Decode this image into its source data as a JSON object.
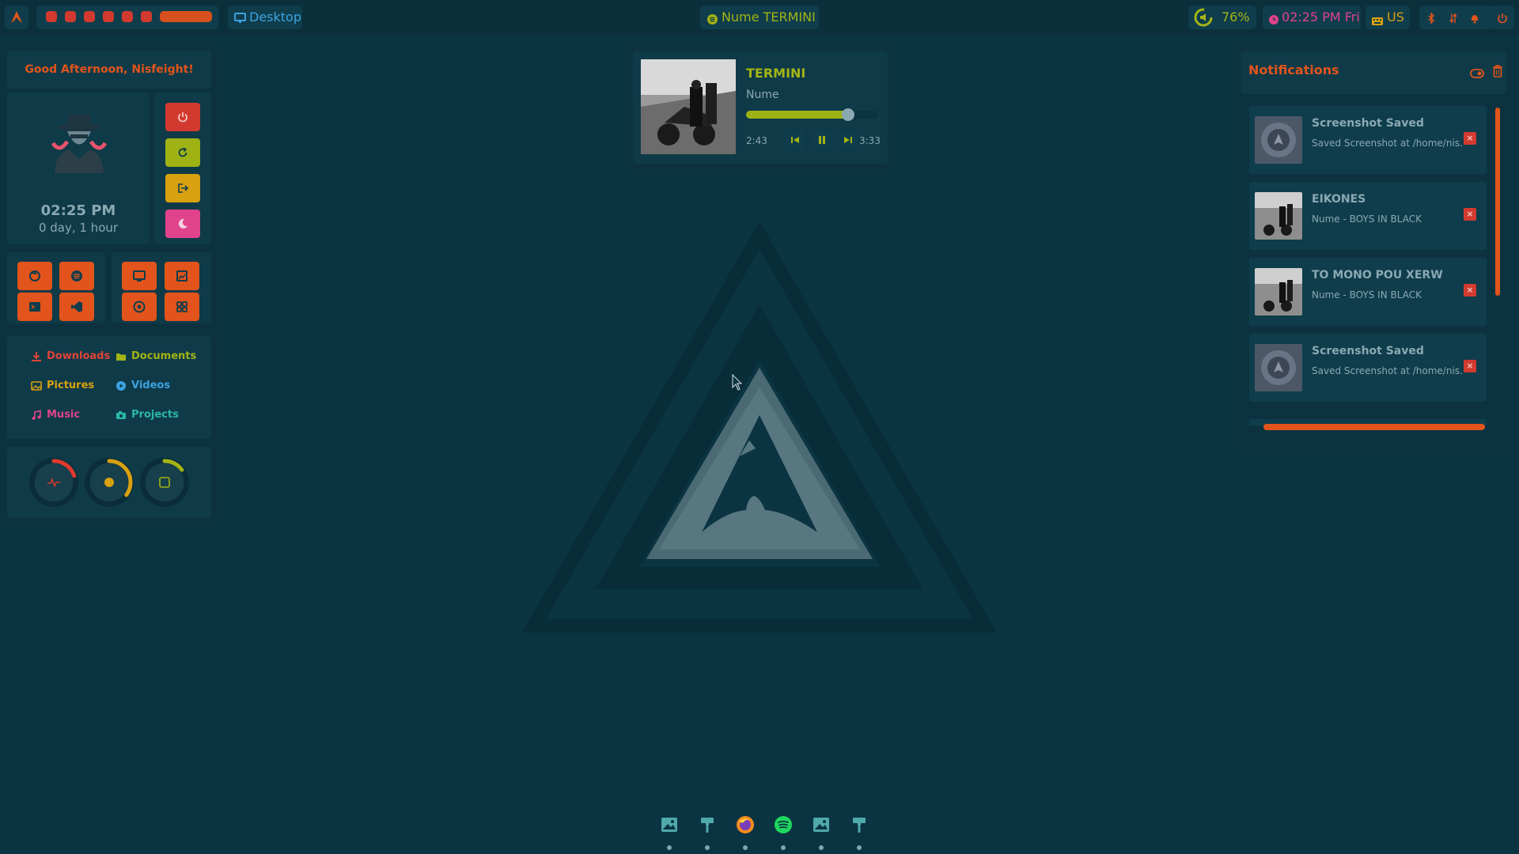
{
  "topbar": {
    "desktop_label": "Desktop",
    "now_playing": "Nume TERMINI",
    "volume": "76%",
    "clock": "02:25 PM Fri",
    "keyboard": "US",
    "workspaces_count": 6
  },
  "profile": {
    "greeting": "Good Afternoon, Nisfeight!",
    "time": "02:25 PM",
    "uptime": "0 day, 1 hour"
  },
  "power_buttons": [
    {
      "name": "power",
      "color": "#d33a2f",
      "icon": "power-icon"
    },
    {
      "name": "reboot",
      "color": "#9fb214",
      "icon": "reboot-icon"
    },
    {
      "name": "logout",
      "color": "#d8a10f",
      "icon": "logout-icon"
    },
    {
      "name": "sleep",
      "color": "#e0438b",
      "icon": "moon-icon"
    }
  ],
  "app_launchers": [
    "firefox-icon",
    "spotify-icon",
    "terminal-icon",
    "vscode-icon"
  ],
  "tool_launchers": [
    "screenshot-icon",
    "screenshot-region-icon",
    "record-icon",
    "grid-icon"
  ],
  "folders": [
    {
      "label": "Downloads",
      "color": "#e04438",
      "icon": "download-icon"
    },
    {
      "label": "Documents",
      "color": "#a3b414",
      "icon": "folder-icon"
    },
    {
      "label": "Pictures",
      "color": "#d8a10f",
      "icon": "image-icon"
    },
    {
      "label": "Videos",
      "color": "#3da2e0",
      "icon": "video-icon"
    },
    {
      "label": "Music",
      "color": "#e0438b",
      "icon": "music-icon"
    },
    {
      "label": "Projects",
      "color": "#2bb8a8",
      "icon": "camera-icon"
    }
  ],
  "gauges": [
    {
      "name": "cpu",
      "color": "#e03a2f",
      "fraction": 0.2
    },
    {
      "name": "ram",
      "color": "#d8a10f",
      "fraction": 0.35
    },
    {
      "name": "disk",
      "color": "#a3b414",
      "fraction": 0.15
    }
  ],
  "player": {
    "title": "TERMINI",
    "artist": "Nume",
    "elapsed": "2:43",
    "total": "3:33",
    "progress": 0.77
  },
  "notifications": {
    "header": "Notifications",
    "items": [
      {
        "title": "Screenshot Saved",
        "body": "Saved Screenshot at /home/nis...",
        "thumb": "screenshot"
      },
      {
        "title": "EIKONES",
        "body": "Nume - BOYS IN BLACK",
        "thumb": "album"
      },
      {
        "title": "TO MONO POU XERW",
        "body": "Nume - BOYS IN BLACK",
        "thumb": "album"
      },
      {
        "title": "Screenshot Saved",
        "body": "Saved Screenshot at /home/nis...",
        "thumb": "screenshot"
      }
    ]
  },
  "dock": [
    "image-viewer-icon",
    "paint-icon",
    "firefox-icon",
    "spotify-icon",
    "image-viewer-icon",
    "paint-icon"
  ],
  "colors": {
    "accent_orange": "#e2541b",
    "background": "#0b3442",
    "greeting": "#e2541b"
  }
}
